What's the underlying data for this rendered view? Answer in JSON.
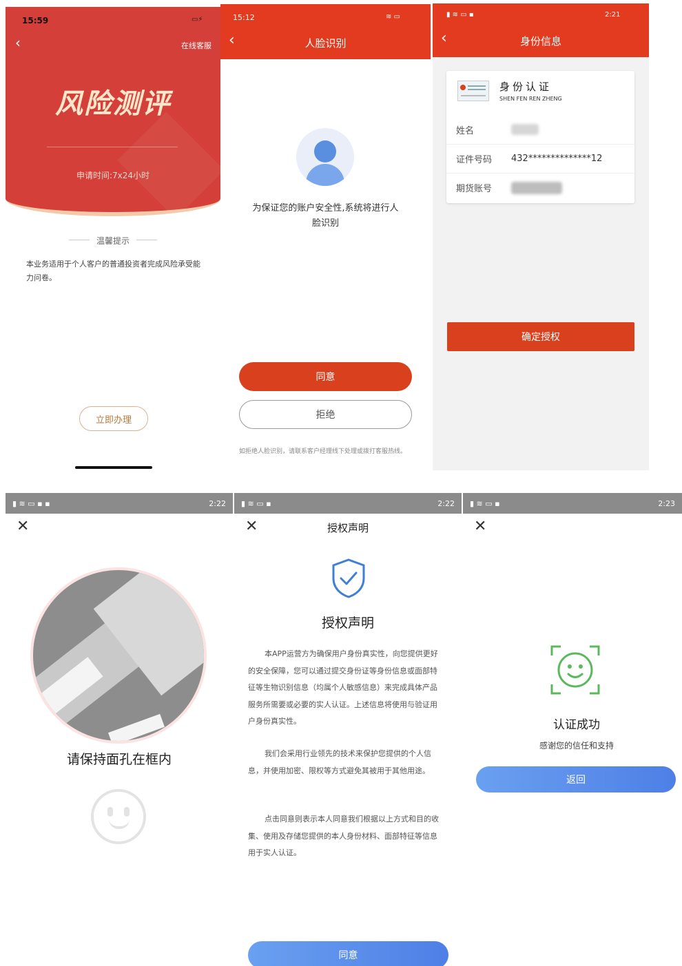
{
  "screen1": {
    "time": "15:59",
    "service_link": "在线客服",
    "hero_title": "风险测评",
    "apply_time": "申请时间:7x24小时",
    "tips_heading": "温馨提示",
    "tips_body": "本业务适用于个人客户的普通投资者完成风险承受能力问卷。",
    "action_button": "立即办理"
  },
  "screen2": {
    "time": "15:12",
    "title": "人脸识别",
    "message": "为保证您的账户安全性,系统将进行人脸识别",
    "agree_button": "同意",
    "reject_button": "拒绝",
    "footnote": "如拒绝人脸识别，请联系客户经理线下处理或拨打客服热线。"
  },
  "screen3": {
    "time": "2:21",
    "title": "身份信息",
    "card_title": "身份认证",
    "card_subtitle": "SHEN FEN REN ZHENG",
    "rows": [
      {
        "label": "姓名",
        "value": ""
      },
      {
        "label": "证件号码",
        "value": "432**************12"
      },
      {
        "label": "期货账号",
        "value": ""
      }
    ],
    "confirm_button": "确定授权"
  },
  "screen4": {
    "time": "2:22",
    "instruction": "请保持面孔在框内"
  },
  "screen5": {
    "time": "2:22",
    "nav_title": "授权声明",
    "heading": "授权声明",
    "paragraphs": [
      "本APP运营方为确保用户身份真实性，向您提供更好的安全保障，您可以通过提交身份证等身份信息或面部特征等生物识别信息（均属个人敏感信息）来完成具体产品服务所需要或必要的实人认证。上述信息将使用与验证用户身份真实性。",
      "我们会采用行业领先的技术来保护您提供的个人信息，并使用加密、限权等方式避免其被用于其他用途。",
      "点击同意则表示本人同意我们根据以上方式和目的收集、使用及存储您提供的本人身份材料、面部特征等信息用于实人认证。"
    ],
    "agree_button": "同意"
  },
  "screen6": {
    "time": "2:23",
    "status_title": "认证成功",
    "status_subtitle": "感谢您的信任和支持",
    "back_button": "返回"
  },
  "colors": {
    "brand_red": "#d43f39",
    "button_red": "#d9401e",
    "button_blue": "#5b8ee9",
    "shield_blue": "#3f7fd6",
    "success_green": "#5bb85d"
  }
}
